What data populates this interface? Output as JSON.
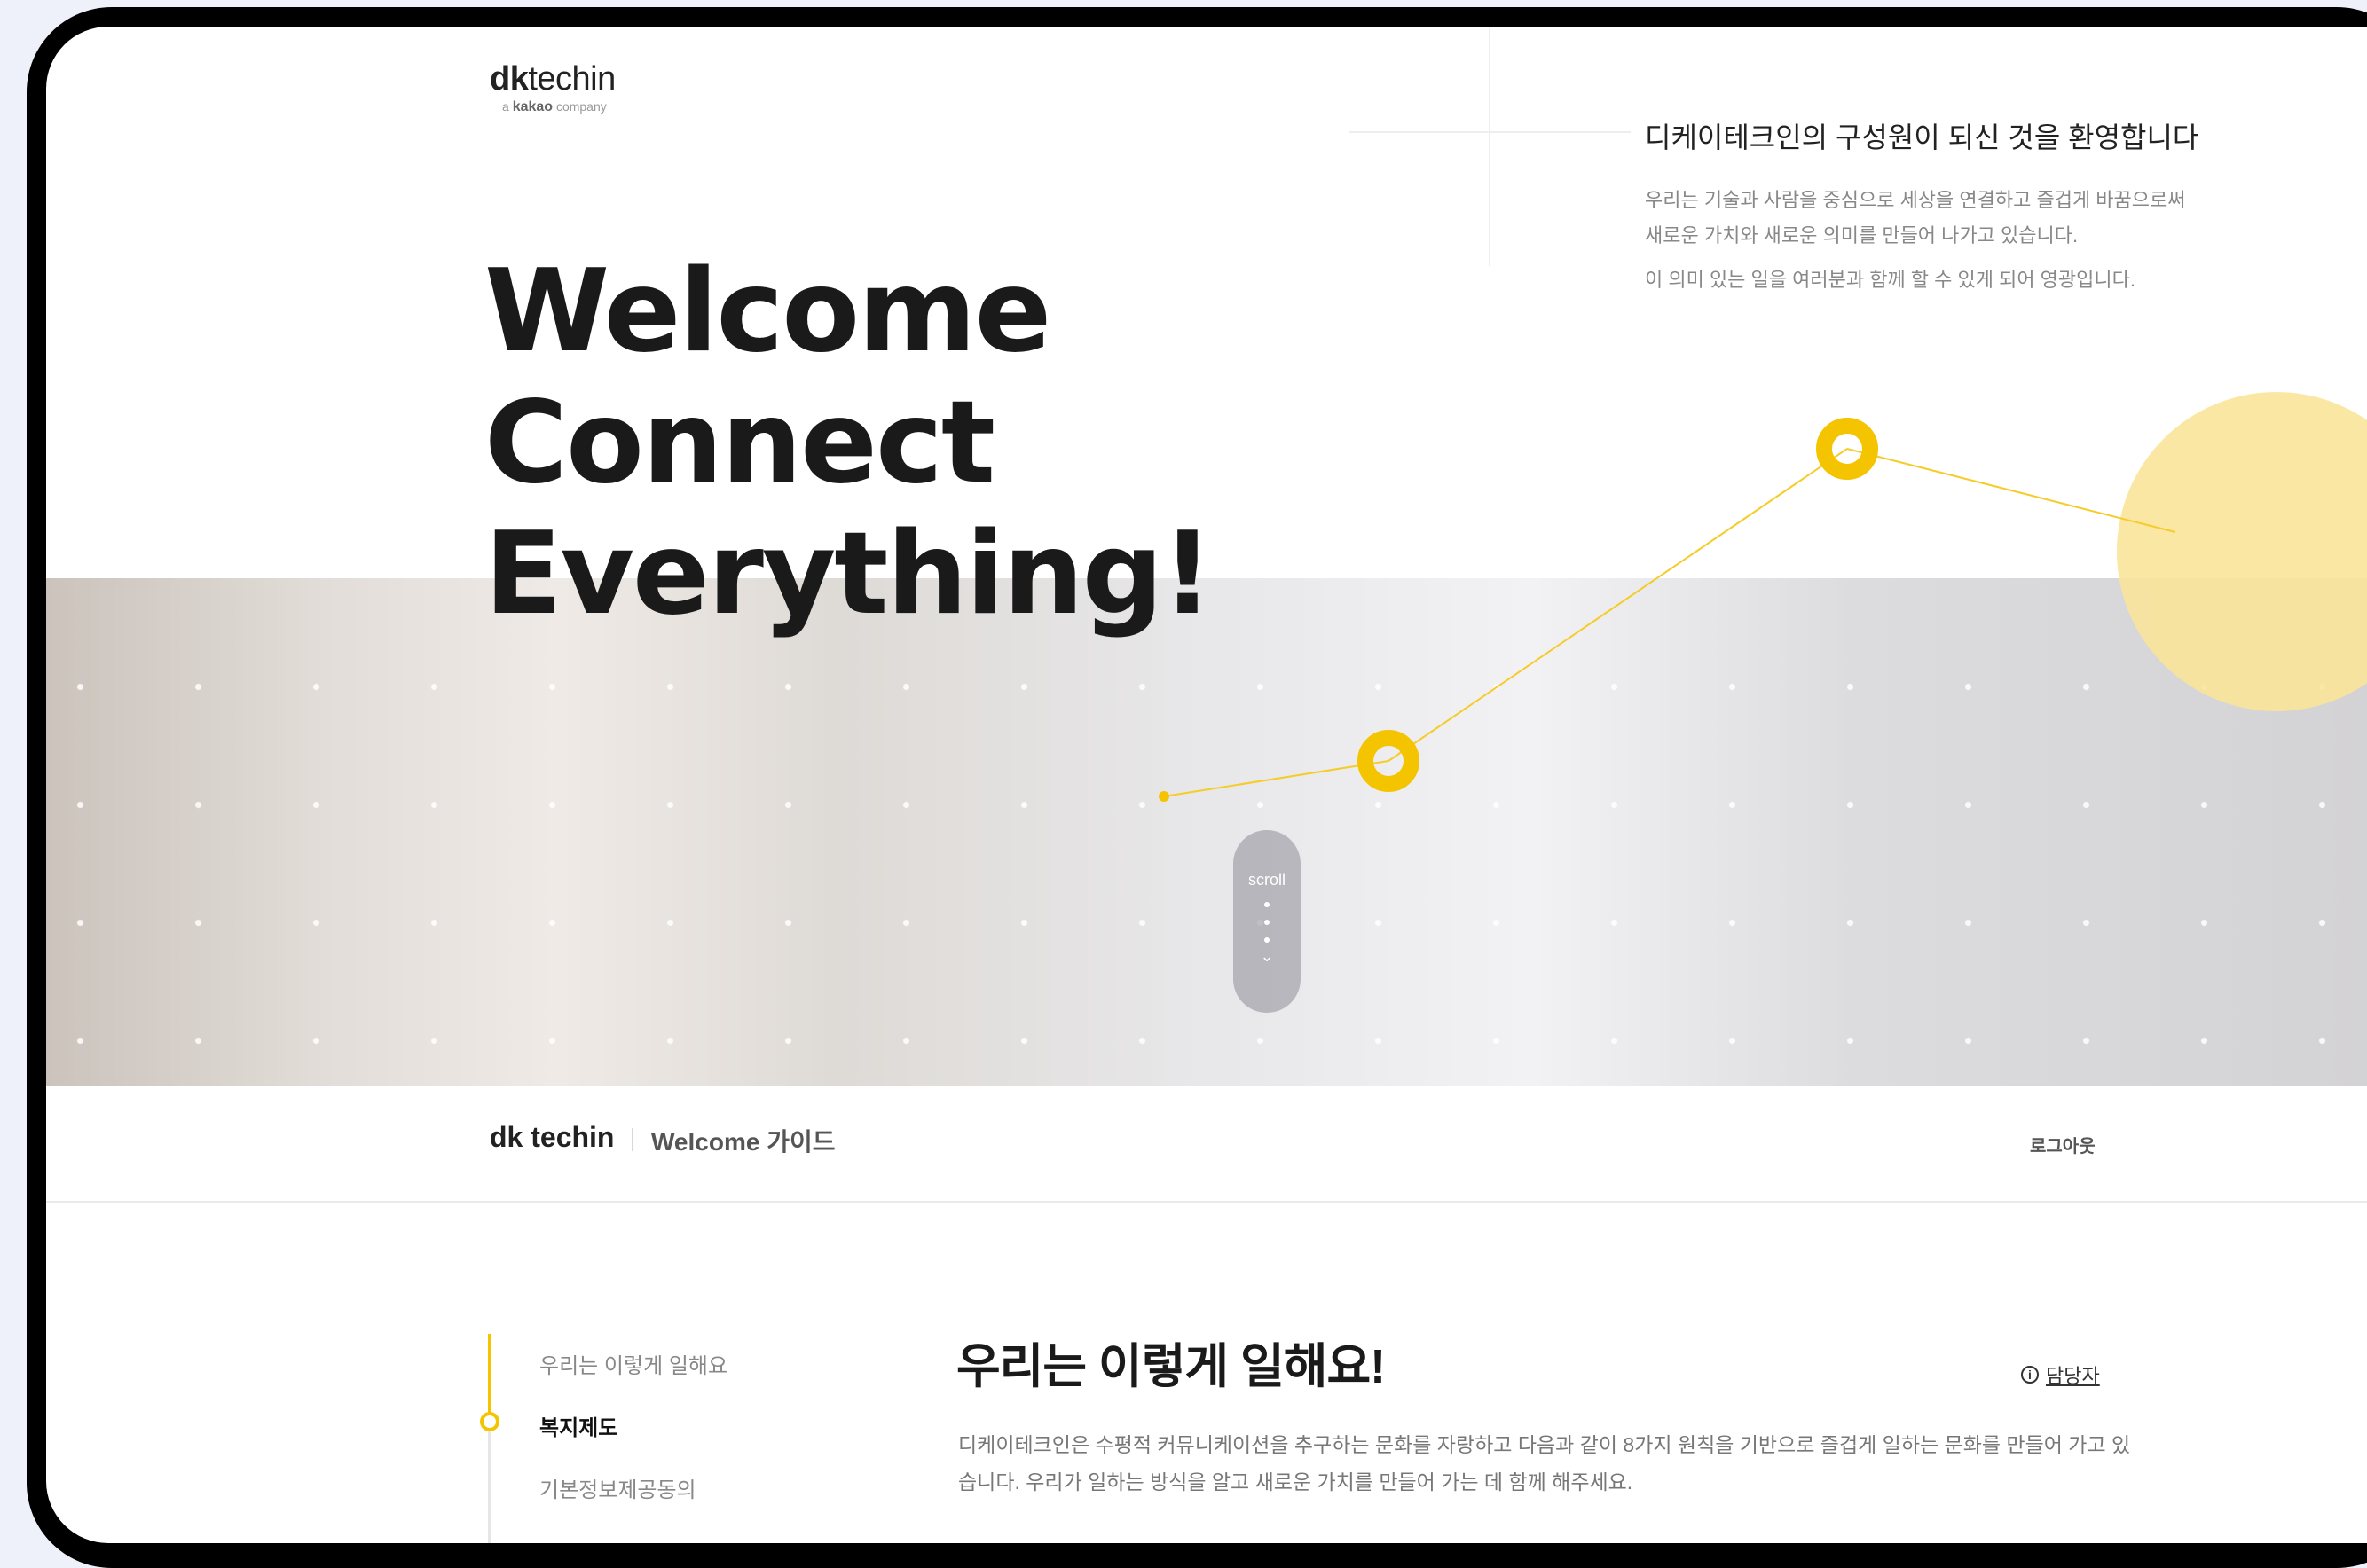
{
  "logo": {
    "main_bold": "dk",
    "main_rest": "techin",
    "sub_prefix": "a ",
    "sub_brand": "kakao",
    "sub_suffix": " company"
  },
  "intro": {
    "title": "디케이테크인의 구성원이 되신 것을 환영합니다",
    "line1": "우리는 기술과 사람을 중심으로 세상을 연결하고 즐겁게 바꿈으로써",
    "line2": "새로운 가치와 새로운 의미를 만들어 나가고 있습니다.",
    "line3": "이 의미 있는 일을 여러분과 함께 할 수 있게 되어 영광입니다."
  },
  "hero": {
    "line1": "Welcome",
    "line2": "Connect",
    "line3": "Everything!"
  },
  "scroll": {
    "label": "scroll",
    "icon": "chevron-down-icon"
  },
  "subnav": {
    "brand": "dk techin",
    "guide": "Welcome 가이드",
    "logout": "로그아웃"
  },
  "sidebar": {
    "items": [
      {
        "label": "우리는 이렇게 일해요",
        "active": false
      },
      {
        "label": "복지제도",
        "active": true
      },
      {
        "label": "기본정보제공동의",
        "active": false
      }
    ]
  },
  "section": {
    "title": "우리는 이렇게 일해요!",
    "manager_label": "담당자",
    "manager_icon": "info-icon",
    "desc_line1": "디케이테크인은 수평적 커뮤니케이션을 추구하는 문화를 자랑하고 다음과 같이 8가지 원칙을 기반으로 즐겁게 일하는 문화를 만들어 가고 있",
    "desc_line2": "습니다. 우리가 일하는 방식을 알고 새로운 가치를 만들어 가는 데 함께 해주세요."
  },
  "colors": {
    "accent": "#f5c400",
    "accent_light": "#fbe49a",
    "text": "#1a1a1a",
    "muted": "#888888"
  }
}
